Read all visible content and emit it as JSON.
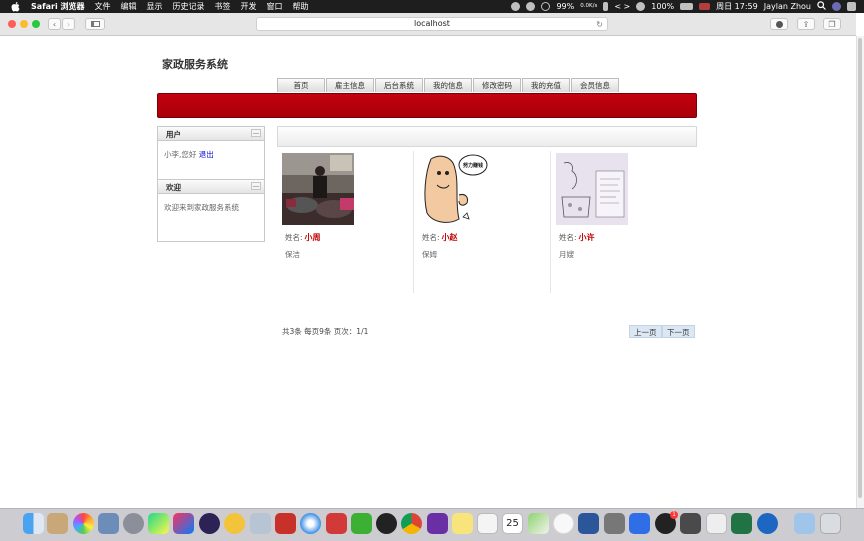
{
  "menubar": {
    "app_name": "Safari 浏览器",
    "items": [
      "文件",
      "编辑",
      "显示",
      "历史记录",
      "书签",
      "开发",
      "窗口",
      "帮助"
    ],
    "status": {
      "battery_percent_a": "99%",
      "network": "0.0K/s",
      "battery_percent_b": "100%",
      "clock": "周日 17:59",
      "user": "Jaylan Zhou"
    }
  },
  "browser": {
    "url": "localhost"
  },
  "site": {
    "title": "家政服务系统",
    "nav_tabs": [
      "首页",
      "雇主信息",
      "后台系统",
      "我的信息",
      "修改密码",
      "我的充值",
      "会员信息"
    ]
  },
  "sidebar": {
    "user_panel": {
      "title": "用户",
      "greeting": "小李,您好",
      "logout_link": "退出",
      "toggle_glyph": "—"
    },
    "welcome_panel": {
      "title": "欢迎",
      "text": "欢迎来到家政服务系统",
      "toggle_glyph": "—"
    }
  },
  "workers": [
    {
      "name_label": "姓名:",
      "name": "小周",
      "role": "保洁",
      "photo_icon": "office-photo"
    },
    {
      "name_label": "姓名:",
      "name": "小赵",
      "role": "保姆",
      "photo_icon": "cartoon-photo",
      "speech_text": "努力赚钱"
    },
    {
      "name_label": "姓名:",
      "name": "小许",
      "role": "月嫂",
      "photo_icon": "sketch-photo"
    }
  ],
  "pagination": {
    "summary": "共3条 每页9条 页次：1/1",
    "prev_label": "上一页",
    "next_label": "下一页"
  },
  "dock": {
    "badge_count": "1",
    "calendar_day": "25",
    "apps": [
      "finder-icon",
      "launchpad-icon",
      "photos-icon",
      "preview-icon",
      "rocket-icon",
      "pycharm-icon",
      "intellij-icon",
      "eclipse-icon",
      "cloud-icon",
      "database-icon",
      "redis-icon",
      "safari-icon",
      "remote-icon",
      "wechat-icon",
      "qq-icon",
      "chrome-icon",
      "axure-icon",
      "notes-icon",
      "textedit-icon",
      "calendar-icon",
      "maps-icon",
      "music-icon",
      "word-icon",
      "settings-icon",
      "baidu-icon",
      "qq-icon",
      "sublime-icon",
      "tablet-icon",
      "excel-icon",
      "browser-icon",
      "folder-icon",
      "trash-icon"
    ]
  },
  "colors": {
    "header_red": "#b50010",
    "name_red": "#c00000",
    "link_blue": "#0000cc",
    "pager_blue": "#dbe7f2"
  }
}
